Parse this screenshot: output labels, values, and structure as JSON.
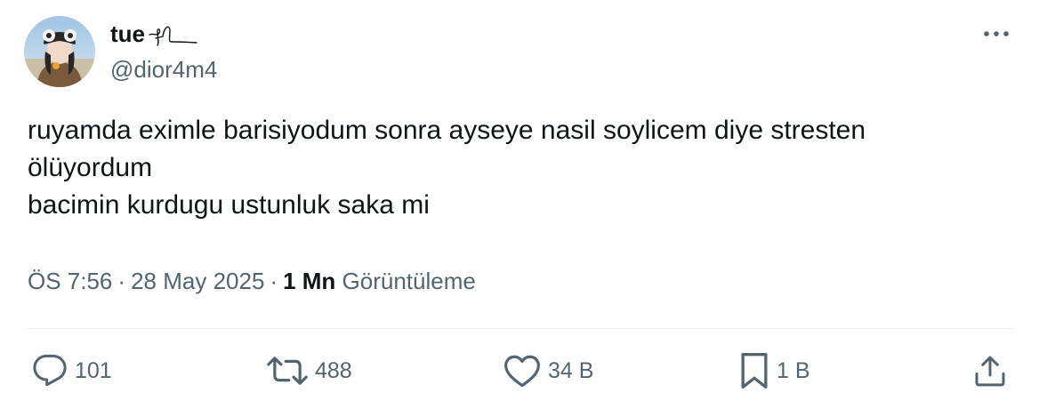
{
  "author": {
    "display_name": "tue",
    "handle": "@dior4m4"
  },
  "tweet": {
    "lines": [
      "ruyamda eximle barisiyodum sonra ayseye nasil soylicem diye stresten",
      "ölüyordum",
      "bacimin kurdugu ustunluk saka mi"
    ]
  },
  "meta": {
    "time": "ÖS 7:56",
    "date": "28 May 2025",
    "separator": "·",
    "views_count": "1 Mn",
    "views_label": "Görüntüleme"
  },
  "actions": {
    "replies": "101",
    "retweets": "488",
    "likes": "34 B",
    "bookmarks": "1 B"
  },
  "icons": {
    "more": "more-icon",
    "reply": "reply-icon",
    "retweet": "retweet-icon",
    "like": "heart-icon",
    "bookmark": "bookmark-icon",
    "share": "share-icon"
  },
  "colors": {
    "text_primary": "#0f1419",
    "text_secondary": "#536471",
    "divider": "#eff3f4"
  }
}
